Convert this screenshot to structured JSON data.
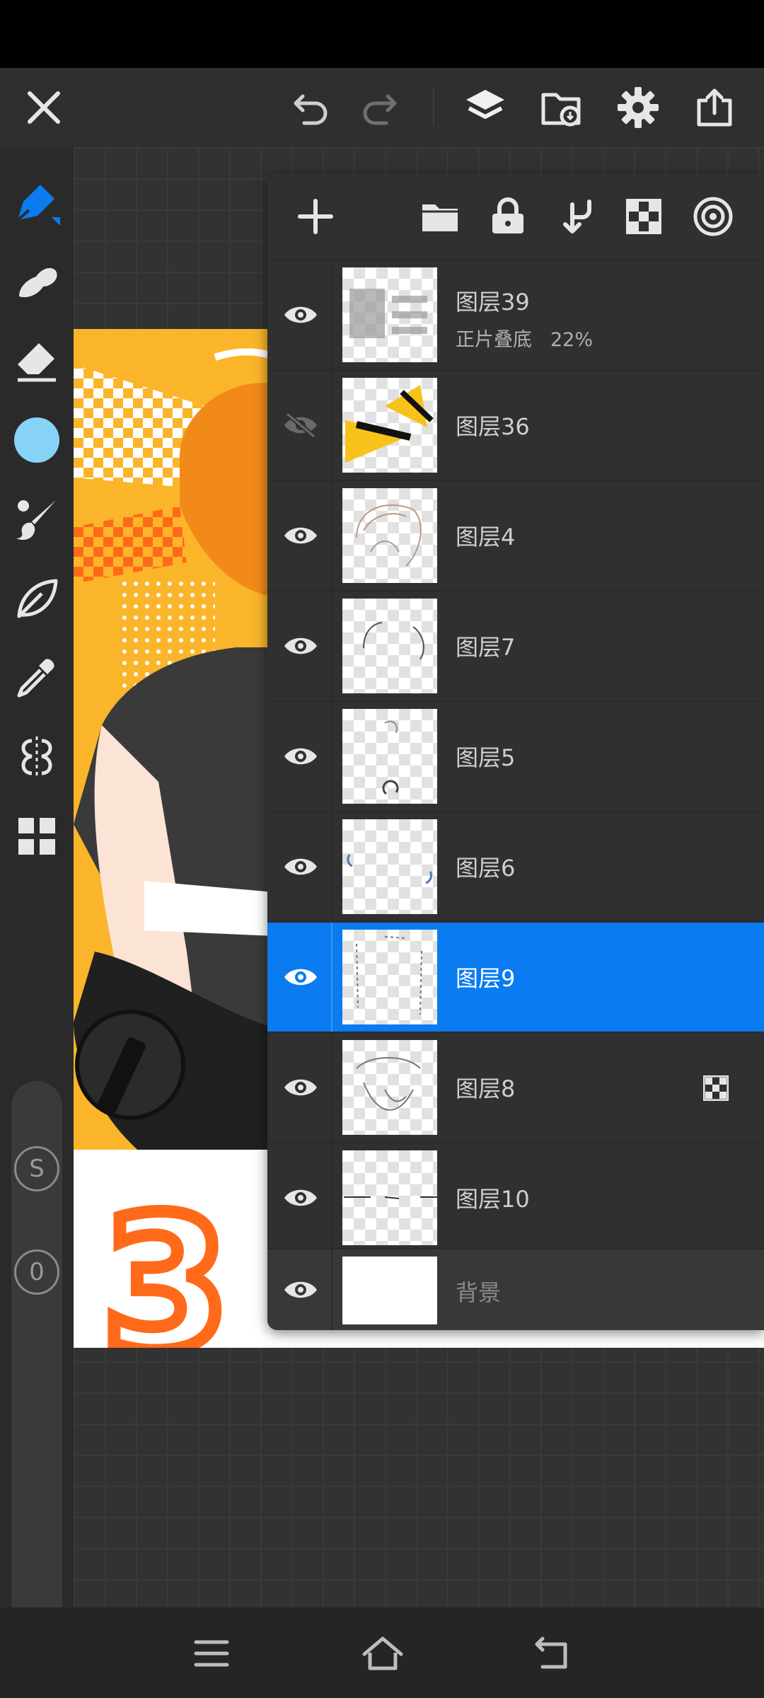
{
  "layers": [
    {
      "name": "图层39",
      "blend_mode": "正片叠底",
      "opacity": "22%",
      "visible": true
    },
    {
      "name": "图层36",
      "visible": false
    },
    {
      "name": "图层4",
      "visible": true
    },
    {
      "name": "图层7",
      "visible": true
    },
    {
      "name": "图层5",
      "visible": true
    },
    {
      "name": "图层6",
      "visible": true
    },
    {
      "name": "图层9",
      "visible": true,
      "selected": true
    },
    {
      "name": "图层8",
      "visible": true,
      "alpha_locked": true
    },
    {
      "name": "图层10",
      "visible": true
    },
    {
      "name": "背景",
      "visible": true,
      "background": true
    }
  ],
  "left_toolbar": {
    "current_color": "#87d3f8",
    "accent": "#0a7bf0",
    "badge_s": "S",
    "badge_o": "0"
  },
  "icons": {
    "top": [
      "close-icon",
      "undo-icon",
      "redo-icon",
      "layers-icon",
      "gallery-import-icon",
      "settings-icon",
      "share-icon"
    ],
    "layers_toolbar": [
      "add-layer-icon",
      "folder-icon",
      "lock-icon",
      "merge-down-icon",
      "checkerboard-icon",
      "radial-icon"
    ],
    "navbar": [
      "menu-icon",
      "home-icon",
      "back-icon"
    ]
  }
}
